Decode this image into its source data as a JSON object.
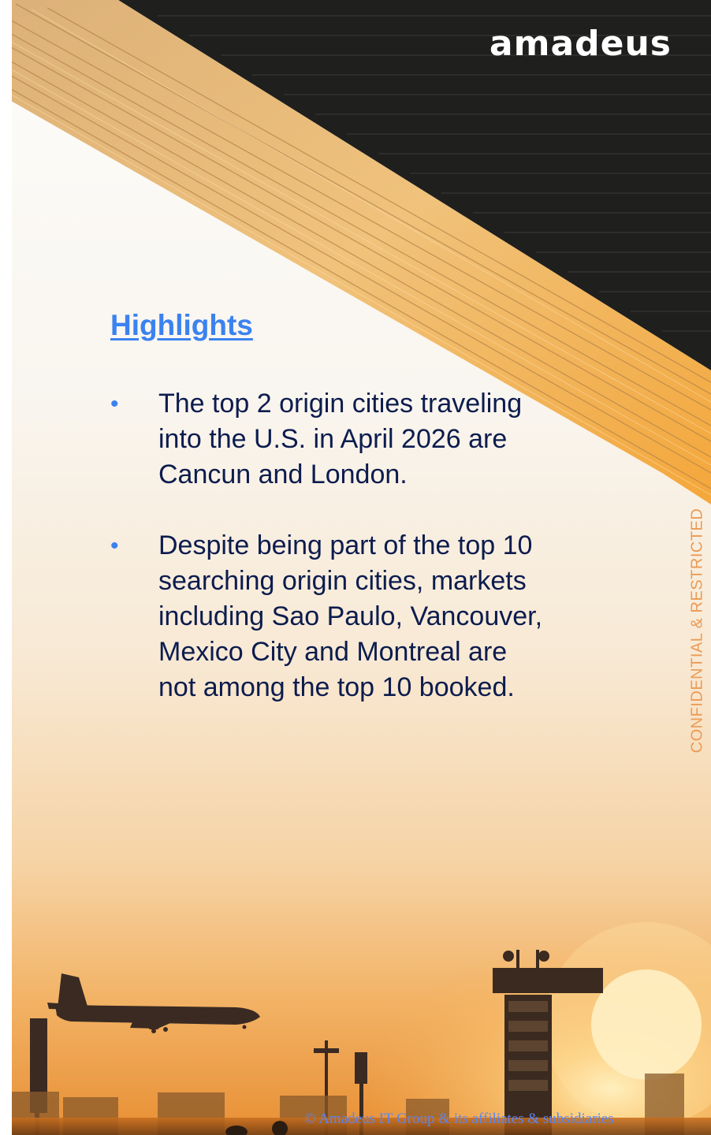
{
  "brand": {
    "logo_text": "amadeus"
  },
  "highlights": {
    "title": "Highlights",
    "bullets": [
      "The top 2 origin cities traveling into the U.S. in April 2026 are Cancun and London.",
      "Despite being part of the top 10 searching origin cities, markets including Sao Paulo, Vancouver, Mexico City and Montreal are not among the top 10 booked."
    ]
  },
  "classification_label": "CONFIDENTIAL & RESTRICTED",
  "footer": {
    "copyright": "© Amadeus IT Group & its affiliates & subsidiaries"
  },
  "colors": {
    "title_blue": "#3b82f0",
    "text_navy": "#0c1c4e",
    "label_orange": "#eb9a55",
    "sky_top": "#f5f1e8",
    "sunset_orange": "#f0b24c",
    "ceiling_dark": "#1d1d1c"
  },
  "icons": {
    "bullet": "bullet-dot",
    "photo": "airport-sunset-photo"
  }
}
